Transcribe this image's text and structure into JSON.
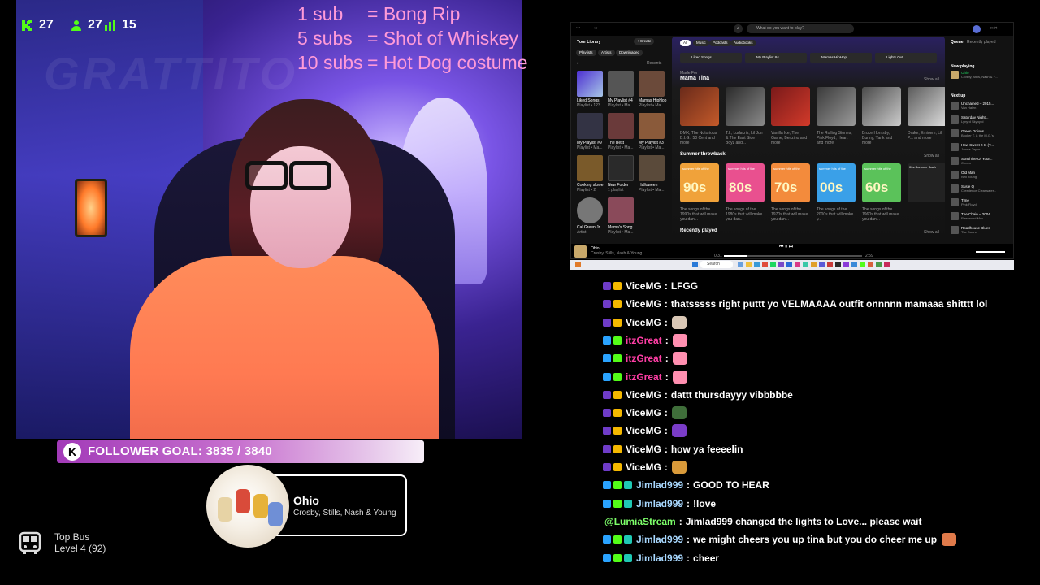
{
  "stream": {
    "stats": [
      {
        "icon": "kick-logo-icon",
        "value": "27"
      },
      {
        "icon": "followers-icon",
        "value": "27"
      },
      {
        "icon": "bars-icon",
        "value": "15"
      }
    ],
    "sub_goals": [
      {
        "amount": "1 sub",
        "reward": "= Bong Rip"
      },
      {
        "amount": "5 subs",
        "reward": "= Shot of Whiskey"
      },
      {
        "amount": "10 subs",
        "reward": "= Hot Dog costume"
      }
    ],
    "follower_goal": {
      "label": "FOLLOWER GOAL: 3835 / 3840",
      "badge": "K",
      "progress": 0.9987
    },
    "now_playing": {
      "title": "Ohio",
      "artist": "Crosby, Stills, Nash & Young"
    },
    "top_bus": {
      "title": "Top Bus",
      "level": "Level 4  (92)"
    }
  },
  "spotify": {
    "search_placeholder": "What do you want to play?",
    "library_title": "Your Library",
    "create_label": "+ Create",
    "filters": [
      "Playlists",
      "Artists",
      "Downloaded"
    ],
    "recents_label": "Recents",
    "library_items": [
      {
        "name": "Liked Songs",
        "sub": "Playlist • 123"
      },
      {
        "name": "My Playlist #4",
        "sub": "Playlist • Ma..."
      },
      {
        "name": "Mamas HipHop",
        "sub": "Playlist • Ma..."
      },
      {
        "name": "My Playlist #9",
        "sub": "Playlist • Ma..."
      },
      {
        "name": "The Best",
        "sub": "Playlist • Ma..."
      },
      {
        "name": "My Playlist #3",
        "sub": "Playlist • Ma..."
      },
      {
        "name": "Cooking slowe",
        "sub": "Playlist • 2"
      },
      {
        "name": "New Folder",
        "sub": "1 playlist"
      },
      {
        "name": "Halloween",
        "sub": "Playlist • Ma..."
      },
      {
        "name": "Cal Green Jr",
        "sub": "Artist"
      },
      {
        "name": "Mama's Song...",
        "sub": "Playlist • Ma..."
      }
    ],
    "chips": [
      "All",
      "Music",
      "Podcasts",
      "Audiobooks"
    ],
    "quick_items": [
      "Liked Songs",
      "My Playlist #4",
      "Mamas HipHop",
      "Lights Out"
    ],
    "made_for": "Made For",
    "section1_title": "Mama Tina",
    "show_all": "Show all",
    "daily_mixes": [
      {
        "label": "Daily Mix 01",
        "desc": "DMX, The Notorious B.I.G., 50 Cent and more"
      },
      {
        "label": "Daily Mix 02",
        "desc": "T.I., Ludacris, Lil Jon & The East Side Boyz and..."
      },
      {
        "label": "Daily Mix 03",
        "desc": "Vanilla Ice, The Game, Benzino and more"
      },
      {
        "label": "Daily Mix 04",
        "desc": "The Rolling Stones, Pink Floyd, Heart and more"
      },
      {
        "label": "Daily Mix 05",
        "desc": "Bruce Hornsby, Bunny, Yank and more"
      },
      {
        "label": "Daily Mix 06",
        "desc": "Drake, Eminem, Lil P... and more"
      }
    ],
    "section2_title": "Summer throwback",
    "throwbacks": [
      {
        "decade": "90s",
        "color": "#f0a23a",
        "desc": "The songs of the 1990s that will make you dan..."
      },
      {
        "decade": "80s",
        "color": "#e9508f",
        "desc": "The songs of the 1980s that will make you dan..."
      },
      {
        "decade": "70s",
        "color": "#f38b3c",
        "desc": "The songs of the 1970s that will make you dan..."
      },
      {
        "decade": "00s",
        "color": "#3aa0e8",
        "desc": "The songs of the 2000s that will make y..."
      },
      {
        "decade": "60s",
        "color": "#5bc25a",
        "desc": "The songs of the 1960s that will make you dan..."
      }
    ],
    "throwback_prefix": "summer hits of the",
    "extra_card": "00s Summer Bash",
    "section3_title": "Recently played",
    "queue_tabs": [
      "Queue",
      "Recently played"
    ],
    "now_playing_label": "Now playing",
    "queue_now": {
      "title": "Ohio",
      "artist": "Crosby, Stills, Nash & Y..."
    },
    "next_up_label": "Next up",
    "queue_items": [
      {
        "title": "Unchained – 2015...",
        "artist": "Van Halen"
      },
      {
        "title": "Saturday Night...",
        "artist": "Lynyrd Skynyrd"
      },
      {
        "title": "Green Onions",
        "artist": "Booker T. & the M.G.'s"
      },
      {
        "title": "How Sweet It Is (T...",
        "artist": "James Taylor"
      },
      {
        "title": "Sunshine Of Your...",
        "artist": "Cream"
      },
      {
        "title": "Old Man",
        "artist": "Neil Young"
      },
      {
        "title": "Susie Q",
        "artist": "Creedence Clearwater..."
      },
      {
        "title": "Time",
        "artist": "Pink Floyd"
      },
      {
        "title": "The Chain – 2004...",
        "artist": "Fleetwood Mac"
      },
      {
        "title": "Roadhouse Blues",
        "artist": "The Doors"
      }
    ],
    "player": {
      "title": "Ohio",
      "artist": "Crosby, Stills, Nash & Young",
      "elapsed": "0:31",
      "duration": "2:59"
    },
    "taskbar_search": "Search"
  },
  "chat": {
    "messages": [
      {
        "user": "ViceMG",
        "color": "#ffffff",
        "badges": [
          "purple",
          "gold"
        ],
        "text": "LFGG",
        "emotes": []
      },
      {
        "user": "ViceMG",
        "color": "#ffffff",
        "badges": [
          "purple",
          "gold"
        ],
        "text": "thatsssss right puttt yo VELMAAAA outfit onnnnn mamaaa shitttt lol",
        "emotes": []
      },
      {
        "user": "ViceMG",
        "color": "#ffffff",
        "badges": [
          "purple",
          "gold"
        ],
        "text": "",
        "emotes": [
          "#d9c7b5"
        ]
      },
      {
        "user": "itzGreat",
        "color": "#ff3ea5",
        "badges": [
          "blue",
          "green"
        ],
        "text": "",
        "emotes": [
          "#ff8fb0"
        ]
      },
      {
        "user": "itzGreat",
        "color": "#ff3ea5",
        "badges": [
          "blue",
          "green"
        ],
        "text": "",
        "emotes": [
          "#ff8fb0"
        ]
      },
      {
        "user": "itzGreat",
        "color": "#ff3ea5",
        "badges": [
          "blue",
          "green"
        ],
        "text": "",
        "emotes": [
          "#ff8fb0"
        ]
      },
      {
        "user": "ViceMG",
        "color": "#ffffff",
        "badges": [
          "purple",
          "gold"
        ],
        "text": "dattt thursdayyy vibbbbbe",
        "emotes": []
      },
      {
        "user": "ViceMG",
        "color": "#ffffff",
        "badges": [
          "purple",
          "gold"
        ],
        "text": "",
        "emotes": [
          "#3f6e3a"
        ]
      },
      {
        "user": "ViceMG",
        "color": "#ffffff",
        "badges": [
          "purple",
          "gold"
        ],
        "text": "",
        "emotes": [
          "#7a3cc8"
        ]
      },
      {
        "user": "ViceMG",
        "color": "#ffffff",
        "badges": [
          "purple",
          "gold"
        ],
        "text": "how ya feeeelin",
        "emotes": []
      },
      {
        "user": "ViceMG",
        "color": "#ffffff",
        "badges": [
          "purple",
          "gold"
        ],
        "text": "",
        "emotes": [
          "#d99a3a"
        ]
      },
      {
        "user": "Jimlad999",
        "color": "#a8d8ff",
        "badges": [
          "blue",
          "green",
          "teal"
        ],
        "text": "GOOD TO HEAR",
        "emotes": []
      },
      {
        "user": "Jimlad999",
        "color": "#a8d8ff",
        "badges": [
          "blue",
          "green",
          "teal"
        ],
        "text": "!love",
        "emotes": []
      },
      {
        "user": "@LumiaStream",
        "color": "#7dff6a",
        "badges": [],
        "text": "Jimlad999 changed the lights to Love... please wait",
        "emotes": []
      },
      {
        "user": "Jimlad999",
        "color": "#a8d8ff",
        "badges": [
          "blue",
          "green",
          "teal"
        ],
        "text": "we might cheers you up tina but you do cheer me up",
        "emotes": [
          "#e07a4a"
        ]
      },
      {
        "user": "Jimlad999",
        "color": "#a8d8ff",
        "badges": [
          "blue",
          "green",
          "teal"
        ],
        "text": "cheer",
        "emotes": []
      }
    ]
  },
  "colors": {
    "goal_pink": "#ff9ad8",
    "kick_green": "#53fc18",
    "badge_purple": "#6f3cc8",
    "badge_gold": "#f5b800",
    "badge_blue": "#2aa3ff",
    "badge_green": "#53fc18",
    "badge_teal": "#1fc8b4"
  }
}
